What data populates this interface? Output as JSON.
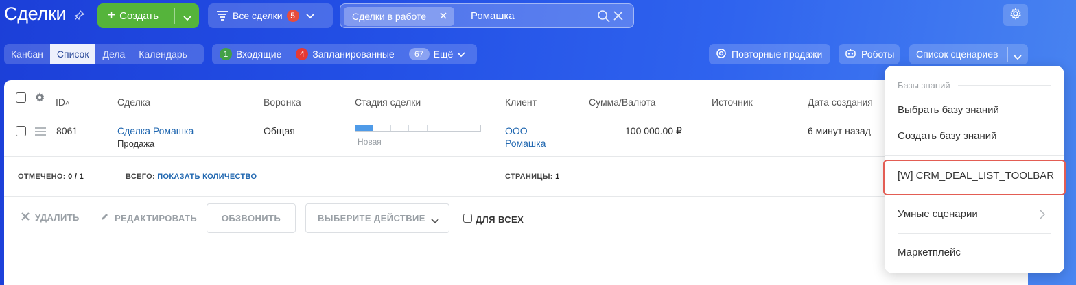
{
  "header": {
    "title": "Сделки",
    "create_label": "Создать",
    "all_deals_label": "Все сделки",
    "all_deals_count": "5",
    "filter_chip": "Сделки в работе",
    "search_value": "Ромашка"
  },
  "views": {
    "tabs": [
      "Канбан",
      "Список",
      "Дела",
      "Календарь"
    ],
    "active": "Список"
  },
  "counters": {
    "incoming_count": "1",
    "incoming_label": "Входящие",
    "planned_count": "4",
    "planned_label": "Запланированные",
    "more_count": "67",
    "more_label": "Ещё"
  },
  "toolbar": {
    "repeat_sales": "Повторные продажи",
    "robots": "Роботы",
    "scenarios": "Список сценариев"
  },
  "grid": {
    "columns": {
      "id": "ID",
      "deal": "Сделка",
      "funnel": "Воронка",
      "stage": "Стадия сделки",
      "client": "Клиент",
      "sum": "Сумма/Валюта",
      "source": "Источник",
      "created": "Дата создания"
    },
    "rows": [
      {
        "id": "8061",
        "title": "Сделка Ромашка",
        "subtitle": "Продажа",
        "funnel": "Общая",
        "stage": "Новая",
        "stage_progress": 0.14,
        "client_line1": "ООО",
        "client_line2": "Ромашка",
        "sum": "100 000.00 ₽",
        "created": "6 минут назад"
      }
    ]
  },
  "footer": {
    "checked_label": "ОТМЕЧЕНО:",
    "checked_value": "0 / 1",
    "total_label": "ВСЕГО:",
    "total_link": "ПОКАЗАТЬ КОЛИЧЕСТВО",
    "pages_label": "СТРАНИЦЫ:",
    "pages_value": "1"
  },
  "actions": {
    "delete": "УДАЛИТЬ",
    "edit": "РЕДАКТИРОВАТЬ",
    "call": "ОБЗВОНИТЬ",
    "choose": "ВЫБЕРИТЕ ДЕЙСТВИЕ",
    "for_all": "ДЛЯ ВСЕХ"
  },
  "menu": {
    "section": "Базы знаний",
    "items": [
      "Выбрать базу знаний",
      "Создать базу знаний",
      "[W] CRM_DEAL_LIST_TOOLBAR",
      "Умные сценарии",
      "Маркетплейс"
    ],
    "highlight_color": "#e35d54"
  },
  "colors": {
    "create_green": "#55b43b",
    "link_blue": "#2067b0",
    "badge_red": "#e74c3c"
  }
}
